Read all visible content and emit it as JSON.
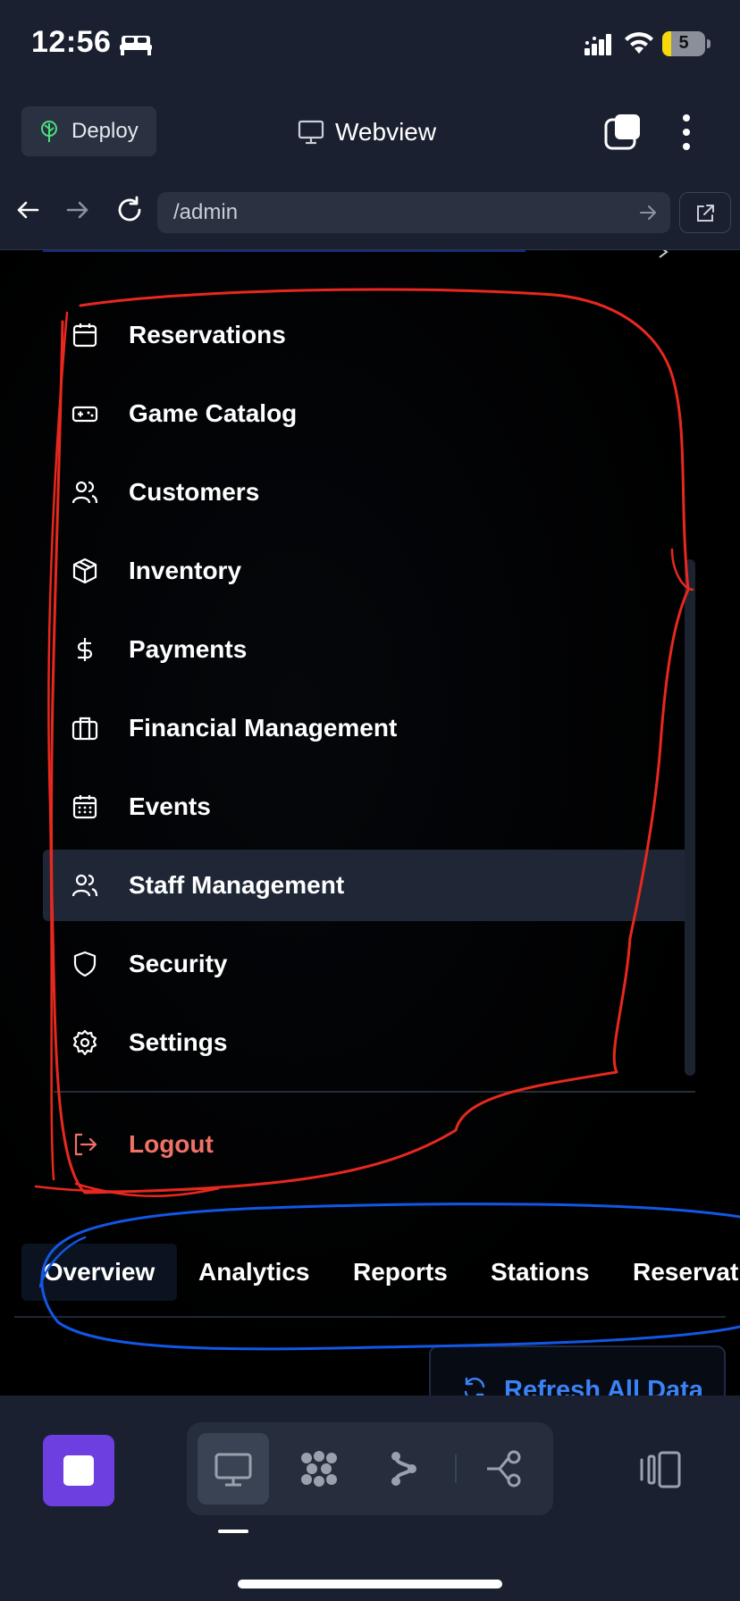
{
  "status_bar": {
    "time": "12:56",
    "battery": "5",
    "icons": [
      "bed-icon",
      "cellular-signal-icon",
      "wifi-icon",
      "battery-icon"
    ]
  },
  "toolbar": {
    "deploy_label": "Deploy",
    "title": "Webview",
    "icons": [
      "deploy-tree-icon",
      "monitor-icon",
      "tabs-icon",
      "kebab-menu-icon"
    ]
  },
  "url_bar": {
    "url": "/admin",
    "icons": [
      "back-arrow-icon",
      "forward-arrow-icon",
      "reload-icon",
      "go-arrow-icon",
      "external-link-icon"
    ]
  },
  "sidebar": {
    "items": [
      {
        "label": "Reservations",
        "icon": "calendar-icon"
      },
      {
        "label": "Game Catalog",
        "icon": "gamepad-icon"
      },
      {
        "label": "Customers",
        "icon": "users-icon"
      },
      {
        "label": "Inventory",
        "icon": "package-icon"
      },
      {
        "label": "Payments",
        "icon": "dollar-icon"
      },
      {
        "label": "Financial Management",
        "icon": "briefcase-icon"
      },
      {
        "label": "Events",
        "icon": "calendar-days-icon"
      },
      {
        "label": "Staff Management",
        "icon": "users-icon",
        "active": true
      },
      {
        "label": "Security",
        "icon": "shield-icon"
      },
      {
        "label": "Settings",
        "icon": "gear-icon"
      }
    ],
    "logout_label": "Logout",
    "logout_icon": "logout-icon"
  },
  "tabs": [
    {
      "label": "Overview",
      "active": true
    },
    {
      "label": "Analytics"
    },
    {
      "label": "Reports"
    },
    {
      "label": "Stations"
    },
    {
      "label": "Reservations"
    }
  ],
  "refresh_label": "Refresh All Data",
  "dock": {
    "icons": [
      "stop-icon",
      "monitor-icon",
      "cluster-icon",
      "branch-icon",
      "share-nodes-icon",
      "panel-toggle-icon"
    ]
  },
  "colors": {
    "accent": "#3b82f6",
    "logout": "#f07167",
    "stop_button": "#6d3fe0",
    "annotation_red": "#e8281e",
    "annotation_blue": "#1257e6"
  }
}
